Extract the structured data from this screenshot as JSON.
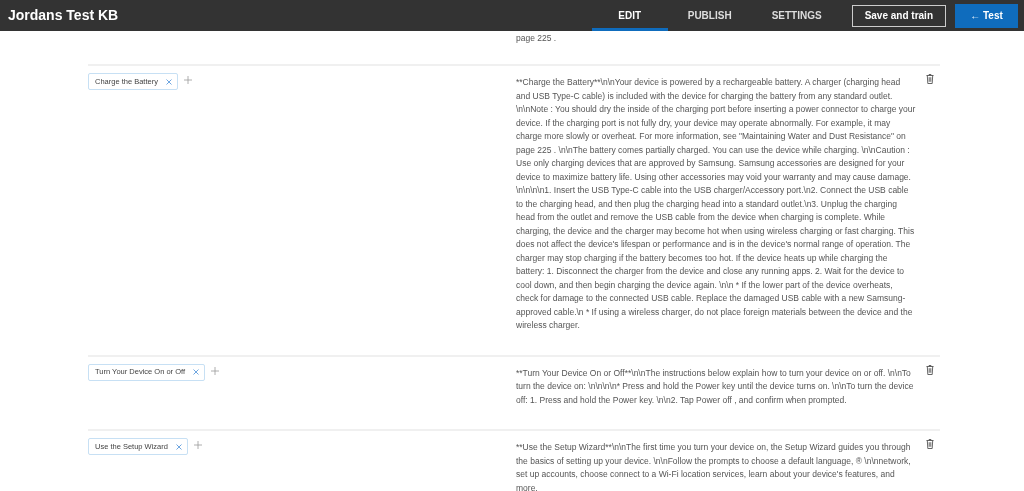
{
  "window": {
    "title": "Jordans Test KB"
  },
  "tabs": [
    {
      "label": "EDIT",
      "selected": true
    },
    {
      "label": "PUBLISH",
      "selected": false
    },
    {
      "label": "SETTINGS",
      "selected": false
    }
  ],
  "buttons": {
    "save": "Save and train",
    "test": "← Test"
  },
  "previous_answer_tail": "page 225 .",
  "qna_pairs": [
    {
      "questions": [
        "Charge the Battery"
      ],
      "answer": "**Charge the Battery**\\n\\nYour device is powered by a rechargeable battery. A charger (charging head and USB Type-C cable) is included with the device for charging the battery from any standard outlet. \\n\\nNote : You should dry the inside of the charging port before inserting a power connector to charge your device. If the charging port is not fully dry, your device may operate abnormally. For example, it may charge more slowly or overheat. For more information, see \"Maintaining Water and Dust Resistance\" on page 225 . \\n\\nThe battery comes partially charged. You can use the device while charging. \\n\\nCaution : Use only charging devices that are approved by Samsung. Samsung accessories are designed for your device to maximize battery life. Using other accessories may void your warranty and may cause damage. \\n\\n\\n\\n1. Insert the USB Type-C cable into the USB charger/Accessory port.\\n2. Connect the USB cable to the charging head, and then plug the charging head into a standard outlet.\\n3. Unplug the charging head from the outlet and remove the USB cable from the device when charging is complete. While charging, the device and the charger may become hot when using wireless charging or fast charging. This does not affect the device's lifespan or performance and is in the device's normal range of operation. The charger may stop charging if the battery becomes too hot. If the device heats up while charging the battery: 1. Disconnect the charger from the device and close any running apps. 2. Wait for the device to cool down, and then begin charging the device again. \\n\\n * If the lower part of the device overheats, check for damage to the connected USB cable. Replace the damaged USB cable with a new Samsung-approved cable.\\n * If using a wireless charger, do not place foreign materials between the device and the wireless charger."
    },
    {
      "questions": [
        "Turn Your Device On or Off"
      ],
      "answer": "**Turn Your Device On or Off**\\n\\nThe instructions below explain how to turn your device on or off. \\n\\nTo turn the device on: \\n\\n\\n\\n* Press and hold the Power key until the device turns on. \\n\\nTo turn the device off: 1. Press and hold the Power key. \\n\\n2. Tap Power off , and confirm when prompted."
    },
    {
      "questions": [
        "Use the Setup Wizard"
      ],
      "answer": "**Use the Setup Wizard**\\n\\nThe first time you turn your device on, the Setup Wizard guides you through the basics of setting up your device. \\n\\nFollow the prompts to choose a default language, ® \\n\\nnetwork, set up accounts, choose connect to a Wi-Fi location services, learn about your device's features, and more."
    }
  ]
}
